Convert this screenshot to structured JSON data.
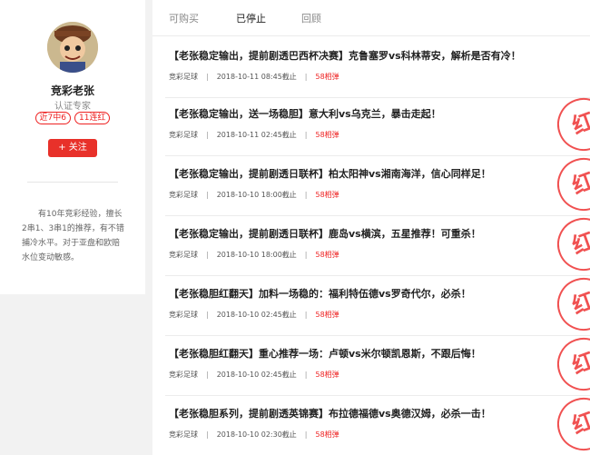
{
  "profile": {
    "name": "竞彩老张",
    "title": "认证专家",
    "badge_recent": "近7中6",
    "badge_streak": "11连红",
    "follow_label": "+ 关注",
    "description": "有10年竞彩经验，擅长2串1、3串1的推荐，有不错捕冷水平。对于亚盘和欧赔水位变动敏感。"
  },
  "tabs": [
    {
      "label": "可购买"
    },
    {
      "label": "已停止"
    },
    {
      "label": "回顾"
    }
  ],
  "active_tab": "已停止",
  "items": [
    {
      "title": "【老张稳定输出，提前剧透巴西杯决赛】克鲁塞罗vs科林蒂安，解析是否有冷！",
      "category": "竞彩足球",
      "deadline": "2018-10-11 08:45截止",
      "price": "58相弹",
      "stamp": ""
    },
    {
      "title": "【老张稳定输出，送一场稳胆】意大利vs乌克兰，暴击走起！",
      "category": "竞彩足球",
      "deadline": "2018-10-11 02:45截止",
      "price": "58相弹",
      "stamp": "红"
    },
    {
      "title": "【老张稳定输出，提前剧透日联杯】柏太阳神vs湘南海洋，信心同样足！",
      "category": "竞彩足球",
      "deadline": "2018-10-10 18:00截止",
      "price": "58相弹",
      "stamp": "红"
    },
    {
      "title": "【老张稳定输出，提前剧透日联杯】鹿岛vs横滨，五星推荐！可重杀！",
      "category": "竞彩足球",
      "deadline": "2018-10-10 18:00截止",
      "price": "58相弹",
      "stamp": "红"
    },
    {
      "title": "【老张稳胆红翻天】加料一场稳的：福利特伍德vs罗奇代尔，必杀！",
      "category": "竞彩足球",
      "deadline": "2018-10-10 02:45截止",
      "price": "58相弹",
      "stamp": "红"
    },
    {
      "title": "【老张稳胆红翻天】重心推荐一场：卢顿vs米尔顿凯恩斯，不跟后悔！",
      "category": "竞彩足球",
      "deadline": "2018-10-10 02:45截止",
      "price": "58相弹",
      "stamp": "红"
    },
    {
      "title": "【老张稳胆系列，提前剧透英锦赛】布拉德福德vs奥德汉姆，必杀一击！",
      "category": "竞彩足球",
      "deadline": "2018-10-10 02:30截止",
      "price": "58相弹",
      "stamp": "红"
    }
  ],
  "colors": {
    "accent": "#e8312a"
  },
  "icons": {
    "avatar": "cartoon-avatar"
  }
}
